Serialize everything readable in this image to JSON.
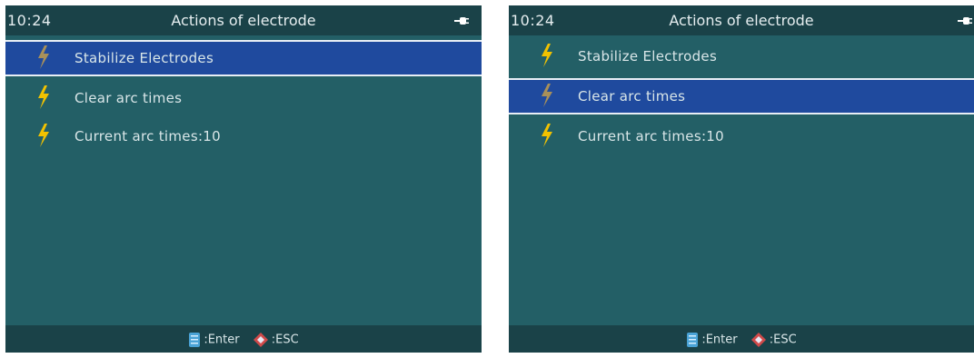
{
  "colors": {
    "screen_bg": "#235f66",
    "bar_bg": "#1a4248",
    "selection_bg": "#1f4a9e",
    "bolt_active": "#f2c200",
    "bolt_selected": "#a8905a"
  },
  "screens": [
    {
      "header": {
        "time": "10:24",
        "title": "Actions of electrode",
        "status_icon": "plug-icon"
      },
      "menu": [
        {
          "label": "Stabilize Electrodes",
          "icon": "lightning-bolt-icon",
          "selected": true
        },
        {
          "label": "Clear arc times",
          "icon": "lightning-bolt-icon",
          "selected": false
        },
        {
          "label": "Current arc times:10",
          "icon": "lightning-bolt-icon",
          "selected": false
        }
      ],
      "footer": {
        "enter_label": ":Enter",
        "esc_label": ":ESC"
      }
    },
    {
      "header": {
        "time": "10:24",
        "title": "Actions of electrode",
        "status_icon": "plug-icon"
      },
      "menu": [
        {
          "label": "Stabilize Electrodes",
          "icon": "lightning-bolt-icon",
          "selected": false
        },
        {
          "label": "Clear arc times",
          "icon": "lightning-bolt-icon",
          "selected": true
        },
        {
          "label": "Current arc times:10",
          "icon": "lightning-bolt-icon",
          "selected": false
        }
      ],
      "footer": {
        "enter_label": ":Enter",
        "esc_label": ":ESC"
      }
    }
  ]
}
